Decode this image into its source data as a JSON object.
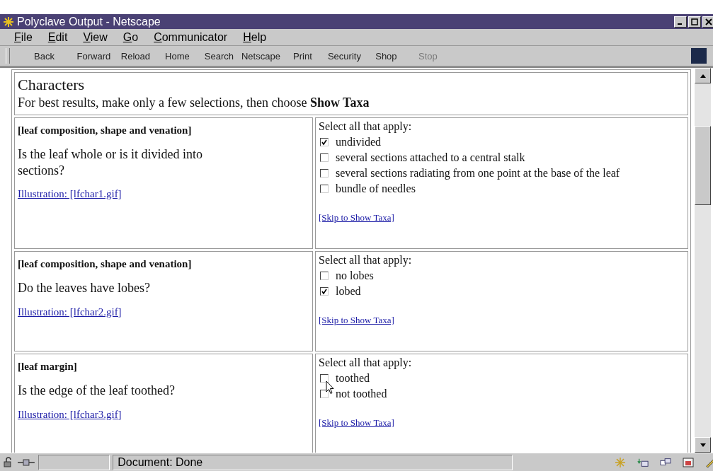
{
  "window": {
    "title": "Polyclave Output - Netscape"
  },
  "menu": [
    "File",
    "Edit",
    "View",
    "Go",
    "Communicator",
    "Help"
  ],
  "toolbar": [
    {
      "label": "Back",
      "disabled": false
    },
    {
      "label": "Forward",
      "disabled": false
    },
    {
      "label": "Reload",
      "disabled": false
    },
    {
      "label": "Home",
      "disabled": false
    },
    {
      "label": "Search",
      "disabled": false
    },
    {
      "label": "Netscape",
      "disabled": false
    },
    {
      "label": "Print",
      "disabled": false
    },
    {
      "label": "Security",
      "disabled": false
    },
    {
      "label": "Shop",
      "disabled": false
    },
    {
      "label": "Stop",
      "disabled": true
    }
  ],
  "page": {
    "heading": "Characters",
    "instruction": "For best results, make only a few selections, then choose **Show Taxa**",
    "characters": [
      {
        "group": "[leaf composition, shape and venation]",
        "question": "Is the leaf whole or is it divided into sections?",
        "illustration": "Illustration: [lfchar1.gif]",
        "prompt": "Select all that apply:",
        "options": [
          {
            "label": "undivided",
            "checked": true
          },
          {
            "label": "several sections attached to a central stalk",
            "checked": false
          },
          {
            "label": "several sections radiating from one point at the base of the leaf",
            "checked": false
          },
          {
            "label": "bundle of needles",
            "checked": false
          }
        ],
        "skip": "[Skip to Show Taxa]"
      },
      {
        "group": "[leaf composition, shape and venation]",
        "question": "Do the leaves have lobes?",
        "illustration": "Illustration: [lfchar2.gif]",
        "prompt": "Select all that apply:",
        "options": [
          {
            "label": "no lobes",
            "checked": false
          },
          {
            "label": "lobed",
            "checked": true
          }
        ],
        "skip": "[Skip to Show Taxa]"
      },
      {
        "group": "[leaf margin]",
        "question": "Is the edge of the leaf toothed?",
        "illustration": "Illustration: [lfchar3.gif]",
        "prompt": "Select all that apply:",
        "options": [
          {
            "label": "toothed",
            "checked": false
          },
          {
            "label": "not toothed",
            "checked": false
          }
        ],
        "skip": "[Skip to Show Taxa]"
      }
    ]
  },
  "status_bar": {
    "text": "Document: Done"
  }
}
